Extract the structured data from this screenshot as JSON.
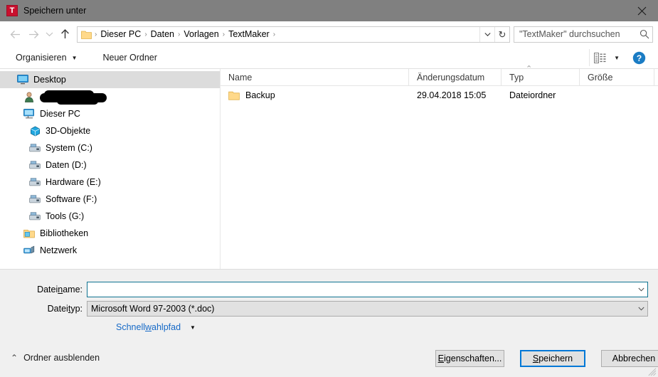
{
  "window": {
    "title": "Speichern unter",
    "app_icon": "textmaker-icon",
    "app_icon_letter": "T",
    "close_label": "✕",
    "titlebar_color": "#808080"
  },
  "navigation": {
    "back_icon": "arrow-left-icon",
    "forward_icon": "arrow-right-icon",
    "recent_icon": "chevron-down-icon",
    "up_icon": "arrow-up-icon",
    "breadcrumb": {
      "folder_icon": "folder-icon",
      "separator": "›",
      "items": [
        "Dieser PC",
        "Daten",
        "Vorlagen",
        "TextMaker"
      ],
      "dropdown_icon": "chevron-down-icon",
      "refresh_icon": "refresh-icon",
      "refresh_glyph": "↻"
    },
    "search": {
      "placeholder": "\"TextMaker\" durchsuchen",
      "value": "",
      "icon": "search-icon"
    }
  },
  "commandbar": {
    "organize_label": "Organisieren",
    "organize_caret": "▼",
    "new_folder_label": "Neuer Ordner",
    "view_icon": "view-layout-icon",
    "view_caret": "▼",
    "help_icon": "help-icon",
    "help_glyph": "?"
  },
  "navpane": {
    "items": [
      {
        "label": "Desktop",
        "icon": "desktop-icon",
        "indent": 0,
        "selected": true,
        "redacted": false
      },
      {
        "label": "",
        "icon": "user-icon",
        "indent": 1,
        "selected": false,
        "redacted": true
      },
      {
        "label": "Dieser PC",
        "icon": "computer-icon",
        "indent": 1,
        "selected": false,
        "redacted": false
      },
      {
        "label": "3D-Objekte",
        "icon": "3d-objects-icon",
        "indent": 2,
        "selected": false,
        "redacted": false
      },
      {
        "label": "System (C:)",
        "icon": "drive-icon",
        "indent": 2,
        "selected": false,
        "redacted": false
      },
      {
        "label": "Daten (D:)",
        "icon": "drive-icon",
        "indent": 2,
        "selected": false,
        "redacted": false
      },
      {
        "label": "Hardware (E:)",
        "icon": "drive-icon",
        "indent": 2,
        "selected": false,
        "redacted": false
      },
      {
        "label": "Software (F:)",
        "icon": "drive-icon",
        "indent": 2,
        "selected": false,
        "redacted": false
      },
      {
        "label": "Tools (G:)",
        "icon": "drive-icon",
        "indent": 2,
        "selected": false,
        "redacted": false
      },
      {
        "label": "Bibliotheken",
        "icon": "libraries-icon",
        "indent": 1,
        "selected": false,
        "redacted": false
      },
      {
        "label": "Netzwerk",
        "icon": "network-icon",
        "indent": 1,
        "selected": false,
        "redacted": false
      }
    ]
  },
  "filelist": {
    "columns": {
      "name": "Name",
      "date": "Änderungsdatum",
      "type": "Typ",
      "size": "Größe"
    },
    "sort_column": "Typ",
    "sort_indicator": "⌃",
    "rows": [
      {
        "name": "Backup",
        "date": "29.04.2018 15:05",
        "type": "Dateiordner",
        "size": "",
        "icon": "folder-icon"
      }
    ]
  },
  "form": {
    "filename_label_pre": "Datei",
    "filename_label_acc": "n",
    "filename_label_post": "ame:",
    "filename_value": "",
    "filetype_label_pre": "Datei",
    "filetype_label_acc": "t",
    "filetype_label_post": "yp:",
    "filetype_value": "Microsoft Word 97-2003 (*.doc)",
    "combo_caret": "ˇ",
    "quickpath_pre": "Schnell",
    "quickpath_acc": "w",
    "quickpath_post": "ahlpfad",
    "quickpath_caret": "▼"
  },
  "bottom": {
    "hide_folders_caret": "⌃",
    "hide_folders_label": "Ordner ausblenden",
    "properties_pre": "",
    "properties_acc": "E",
    "properties_post": "igenschaften...",
    "save_acc": "S",
    "save_post": "peichern",
    "cancel_label": "Abbrechen"
  }
}
